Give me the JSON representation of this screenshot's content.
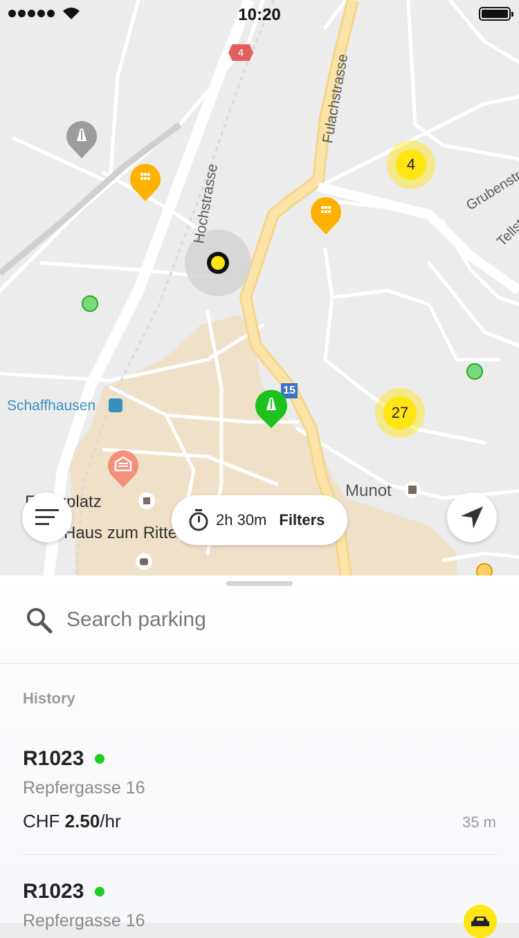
{
  "status_bar": {
    "time": "10:20"
  },
  "map": {
    "route_badge": "4",
    "road_badge": "15",
    "street_labels": {
      "hochstrasse": "Hochstrasse",
      "fulachstrasse": "Fulachstrasse",
      "grubenstrasse": "Grubenstra",
      "tellstrasse": "Tellst"
    },
    "place_labels": {
      "schaffhausen": "Schaffhausen",
      "munot": "Munot",
      "platz": "F    vagplatz",
      "haus": "Haus zum Ritte"
    },
    "clusters": [
      {
        "count": "4"
      },
      {
        "count": "27"
      }
    ],
    "colors": {
      "cluster": "#ffe512",
      "parking_orange": "#ffb100",
      "parking_green": "#22cc22",
      "location_dot": "#ffe512"
    }
  },
  "controls": {
    "timer": "2h 30m",
    "filters_label": "Filters"
  },
  "sheet": {
    "search_placeholder": "Search parking",
    "history_title": "History",
    "items": [
      {
        "code": "R1023",
        "address": "Repfergasse 16",
        "currency": "CHF",
        "price": "2.50",
        "unit": "/hr",
        "distance": "35 m"
      },
      {
        "code": "R1023",
        "address": "Repfergasse 16"
      }
    ]
  }
}
